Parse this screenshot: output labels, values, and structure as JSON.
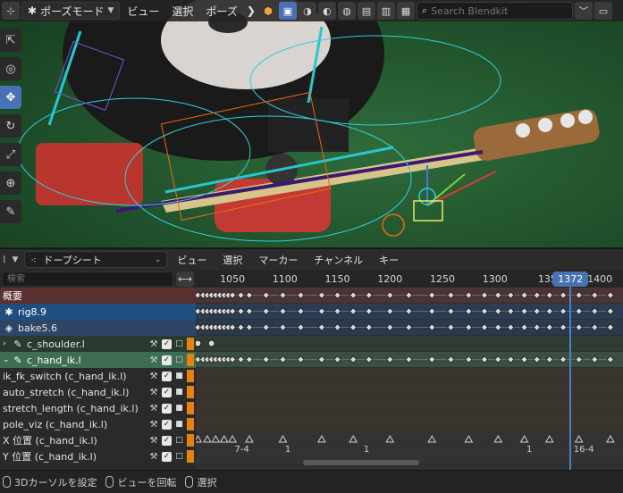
{
  "viewport_header": {
    "mode": "ポーズモード",
    "menus": [
      "ビュー",
      "選択",
      "ポーズ"
    ],
    "search_placeholder": "Search Blendkit"
  },
  "tools": [
    {
      "icon": "select-cursor-icon",
      "glyph": "⇱",
      "active": false
    },
    {
      "icon": "cursor-3d-icon",
      "glyph": "◎",
      "active": false
    },
    {
      "icon": "move-icon",
      "glyph": "✥",
      "active": true
    },
    {
      "icon": "rotate-icon",
      "glyph": "↻",
      "active": false
    },
    {
      "icon": "scale-icon",
      "glyph": "⤢",
      "active": false
    },
    {
      "icon": "transform-icon",
      "glyph": "⊕",
      "active": false
    },
    {
      "icon": "annotate-icon",
      "glyph": "✎",
      "active": false
    }
  ],
  "dopesheet_header": {
    "mode": "ドープシート",
    "menus": [
      "ビュー",
      "選択",
      "マーカー",
      "チャンネル",
      "キー"
    ]
  },
  "channels": {
    "search_placeholder": "検索",
    "rows": [
      {
        "label": "概要",
        "kind": "summary",
        "bg": "#5a3130",
        "text": "#ffffff",
        "icon": "",
        "tail": false
      },
      {
        "label": "rig8.9",
        "kind": "object",
        "bg": "#1f4f80",
        "text": "#ffffff",
        "icon": "armature-icon",
        "glyph": "✱",
        "tail": false
      },
      {
        "label": "bake5.6",
        "kind": "action",
        "bg": "#2d4566",
        "text": "#e6e6e6",
        "icon": "action-icon",
        "glyph": "◈",
        "tail": false
      },
      {
        "label": "c_shoulder.l",
        "kind": "group",
        "bg": "#293b30",
        "text": "#e6e6e6",
        "icon": "bone-icon",
        "glyph": "✎",
        "tail": true,
        "lock": "unlocked"
      },
      {
        "label": "c_hand_ik.l",
        "kind": "group-selected",
        "bg": "#3d6e53",
        "text": "#ffffff",
        "icon": "bone-icon",
        "glyph": "✎",
        "tail": true,
        "lock": "unlocked"
      },
      {
        "label": "ik_fk_switch (c_hand_ik.l)",
        "kind": "fcurve",
        "bg": "#2a2a2a",
        "text": "#e2e2e2",
        "tail": true,
        "lock": "locked"
      },
      {
        "label": "auto_stretch (c_hand_ik.l)",
        "kind": "fcurve",
        "bg": "#2a2a2a",
        "text": "#e2e2e2",
        "tail": true,
        "lock": "locked"
      },
      {
        "label": "stretch_length (c_hand_ik.l)",
        "kind": "fcurve",
        "bg": "#2a2a2a",
        "text": "#e2e2e2",
        "tail": true,
        "lock": "locked"
      },
      {
        "label": "pole_viz (c_hand_ik.l)",
        "kind": "fcurve",
        "bg": "#2a2a2a",
        "text": "#e2e2e2",
        "tail": true,
        "lock": "locked"
      },
      {
        "label": "X 位置 (c_hand_ik.l)",
        "kind": "fcurve",
        "bg": "#2a2a2a",
        "text": "#e2e2e2",
        "tail": true,
        "lock": "unlocked"
      },
      {
        "label": "Y 位置 (c_hand_ik.l)",
        "kind": "fcurve",
        "bg": "#2a2a2a",
        "text": "#e2e2e2",
        "tail": true,
        "lock": "unlocked"
      }
    ]
  },
  "timeline": {
    "ticks": [
      1050,
      1100,
      1150,
      1200,
      1250,
      1300,
      1350,
      1400
    ],
    "tick_labels": [
      "1050",
      "1100",
      "1150",
      "1200",
      "1250",
      "1300",
      "135",
      "1400"
    ],
    "current_frame": 1372,
    "frame_start": 1015,
    "frame_end": 1422,
    "keyframes_main": [
      1017,
      1022,
      1026,
      1030,
      1034,
      1038,
      1042,
      1046,
      1050,
      1058,
      1066,
      1082,
      1098,
      1115,
      1135,
      1150,
      1165,
      1180,
      1200,
      1218,
      1240,
      1258,
      1275,
      1290,
      1303,
      1315,
      1328,
      1340,
      1352,
      1365,
      1380,
      1395,
      1410
    ],
    "keyframes_shoulder": [
      1017,
      1030
    ],
    "row_labels": [
      "7-4",
      "1",
      "1",
      "1",
      "16-4"
    ],
    "row_label_frames": [
      1052,
      1100,
      1175,
      1330,
      1375
    ]
  },
  "statusbar": {
    "items": [
      "3Dカーソルを設定",
      "ビューを回転",
      "選択"
    ]
  },
  "colors": {
    "accent": "#4772b3",
    "channel_swatch": "#e7820f"
  }
}
